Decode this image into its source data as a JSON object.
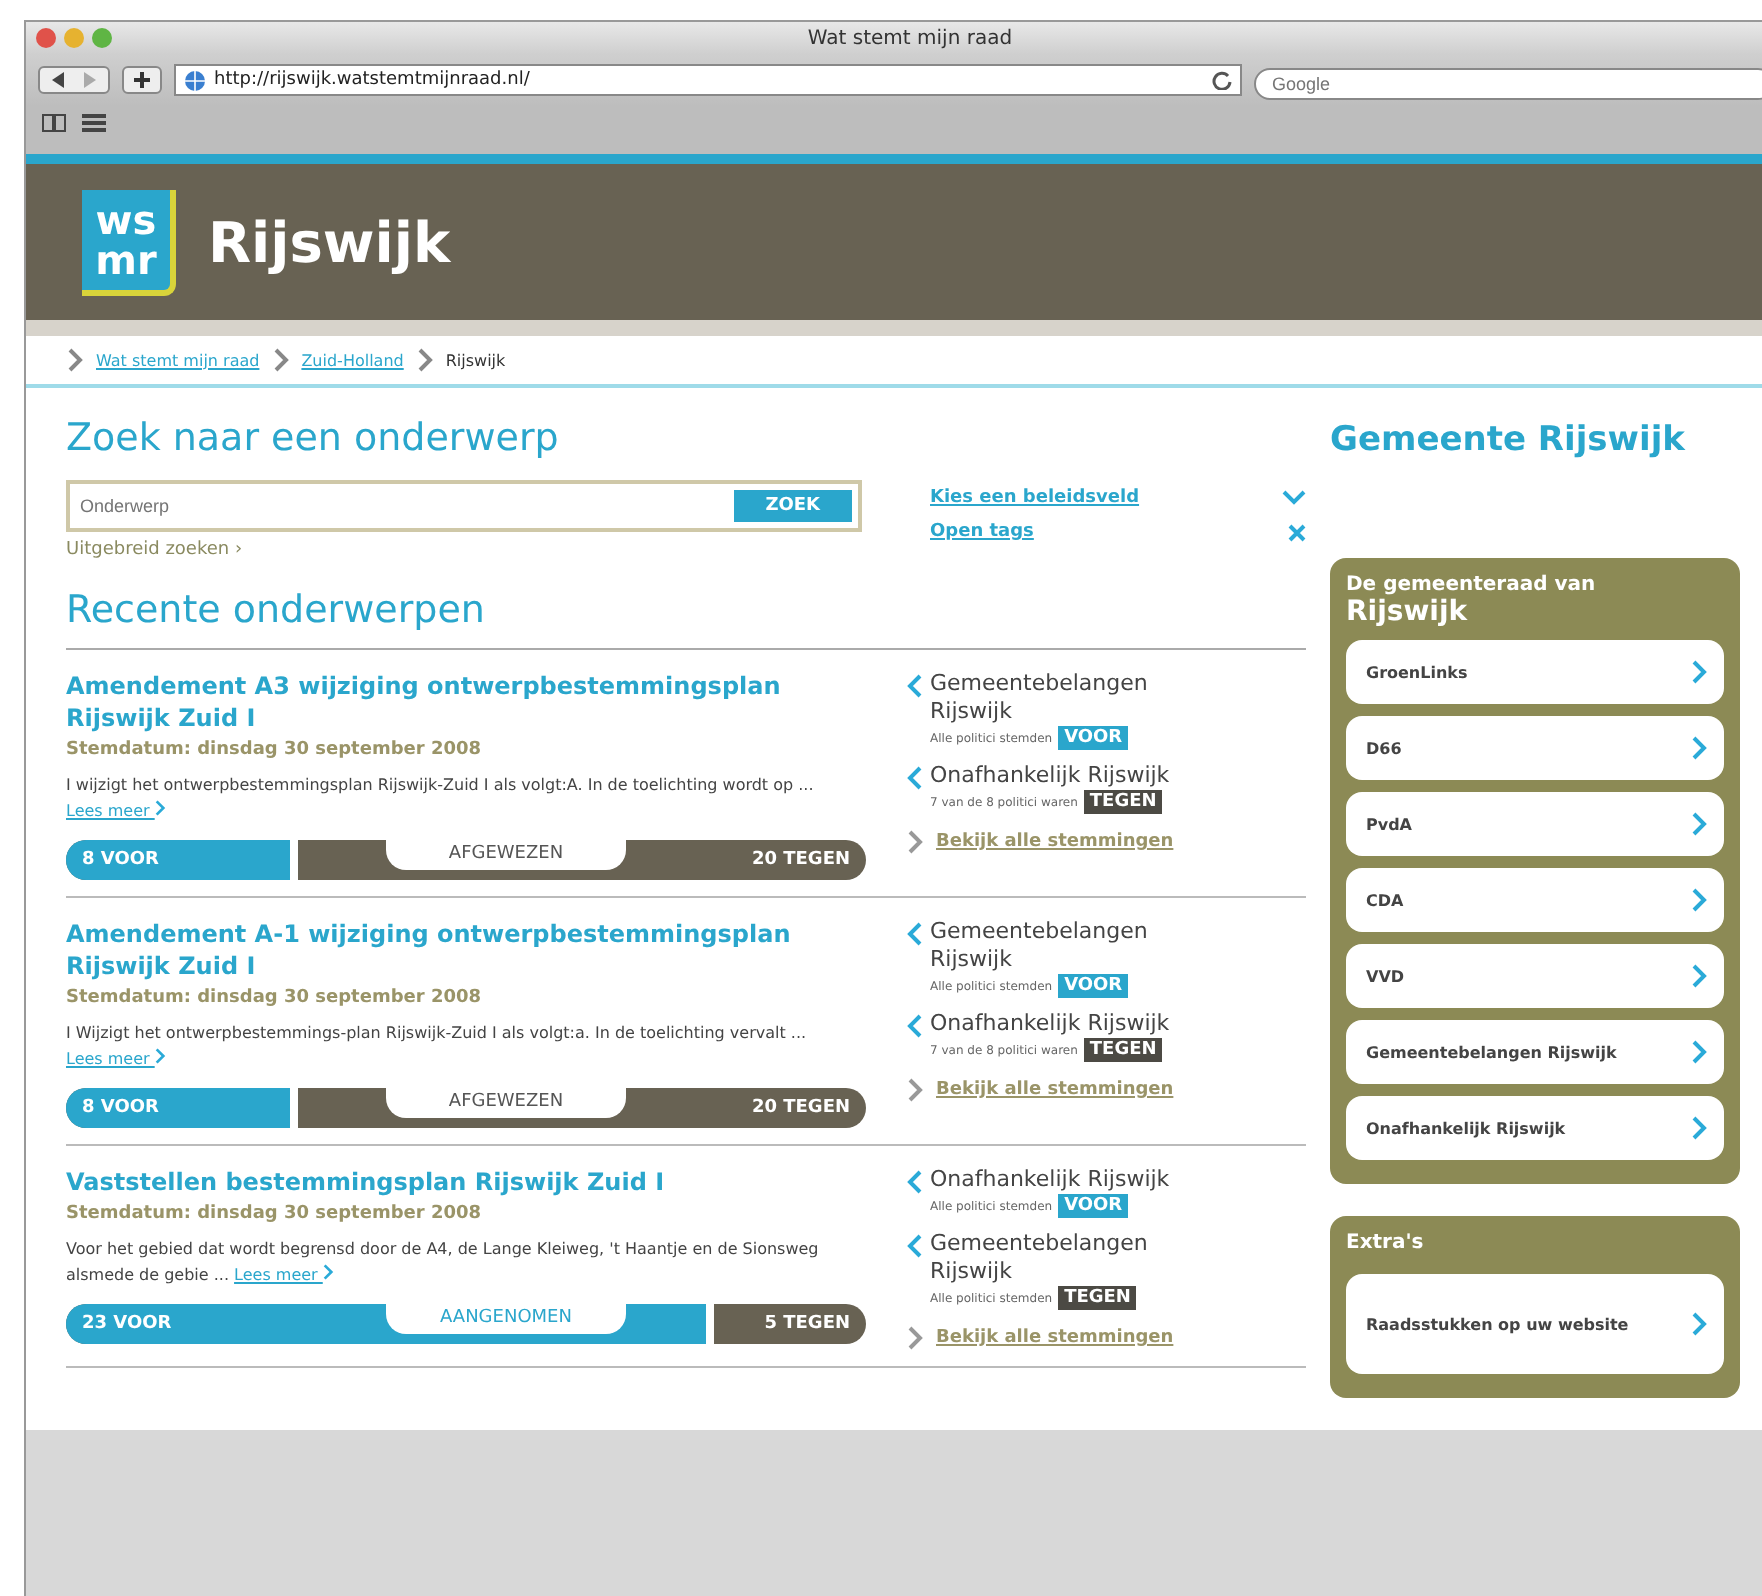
{
  "window": {
    "title": "Wat stemt mijn raad"
  },
  "toolbar": {
    "url": "http://rijswijk.watstemtmijnraad.nl/",
    "search_placeholder": "Google"
  },
  "header": {
    "logo_top": "ws",
    "logo_bottom": "mr",
    "title": "Rijswijk"
  },
  "breadcrumbs": [
    {
      "label": "Wat stemt mijn raad",
      "link": true
    },
    {
      "label": "Zuid-Holland",
      "link": true
    },
    {
      "label": "Rijswijk",
      "link": false
    }
  ],
  "search": {
    "title": "Zoek naar een onderwerp",
    "placeholder": "Onderwerp",
    "button": "ZOEK",
    "advanced": "Uitgebreid zoeken ›",
    "filters": [
      {
        "label": "Kies een beleidsveld",
        "kind": "dropdown"
      },
      {
        "label": "Open tags",
        "kind": "close"
      }
    ]
  },
  "recent": {
    "title": "Recente onderwerpen",
    "items": [
      {
        "title": "Amendement A3 wijziging ontwerpbestemmingsplan Rijswijk Zuid I",
        "date": "Stemdatum: dinsdag 30 september 2008",
        "summary": "I wijzigt het ontwerpbestemmingsplan Rijswijk-Zuid I als volgt:A. In de toelichting wordt op ...",
        "more": "Lees meer",
        "voor": "8 VOOR",
        "tegen": "20 TEGEN",
        "level": 0.29,
        "result": "AFGEWEZEN",
        "parties": [
          {
            "name": "Gemeentebelangen Rijswijk",
            "note": "Alle politici stemden",
            "vote": "VOOR",
            "kind": "voor"
          },
          {
            "name": "Onafhankelijk Rijswijk",
            "note": "7 van de 8 politici waren",
            "vote": "TEGEN",
            "kind": "tegen"
          }
        ],
        "all_votes": "Bekijk alle stemmingen"
      },
      {
        "title": "Amendement A-1 wijziging ontwerpbestemmingsplan Rijswijk Zuid I",
        "date": "Stemdatum: dinsdag 30 september 2008",
        "summary": "I Wijzigt het ontwerpbestemmings-plan Rijswijk-Zuid I als volgt:a. In de toelichting vervalt ...",
        "more": "Lees meer",
        "voor": "8 VOOR",
        "tegen": "20 TEGEN",
        "level": 0.29,
        "result": "AFGEWEZEN",
        "parties": [
          {
            "name": "Gemeentebelangen Rijswijk",
            "note": "Alle politici stemden",
            "vote": "VOOR",
            "kind": "voor"
          },
          {
            "name": "Onafhankelijk Rijswijk",
            "note": "7 van de 8 politici waren",
            "vote": "TEGEN",
            "kind": "tegen"
          }
        ],
        "all_votes": "Bekijk alle stemmingen"
      },
      {
        "title": "Vaststellen bestemmingsplan Rijswijk Zuid I",
        "date": "Stemdatum: dinsdag 30 september 2008",
        "summary": "Voor het gebied dat wordt begrensd door de A4, de Lange Kleiweg, 't Haantje en de Sionsweg alsmede de gebie ...",
        "more": "Lees meer",
        "voor": "23 VOOR",
        "tegen": "5 TEGEN",
        "level": 0.81,
        "result": "AANGENOMEN",
        "parties": [
          {
            "name": "Onafhankelijk Rijswijk",
            "note": "Alle politici stemden",
            "vote": "VOOR",
            "kind": "voor"
          },
          {
            "name": "Gemeentebelangen Rijswijk",
            "note": "Alle politici stemden",
            "vote": "TEGEN",
            "kind": "tegen"
          }
        ],
        "all_votes": "Bekijk alle stemmingen"
      }
    ]
  },
  "sidebar": {
    "title": "Gemeente Rijswijk",
    "council": {
      "heading": "De gemeenteraad van",
      "place": "Rijswijk",
      "parties": [
        "GroenLinks",
        "D66",
        "PvdA",
        "CDA",
        "VVD",
        "Gemeentebelangen Rijswijk",
        "Onafhankelijk Rijswijk"
      ]
    },
    "extras": {
      "heading": "Extra's",
      "items": [
        "Raadsstukken op uw website"
      ]
    }
  }
}
